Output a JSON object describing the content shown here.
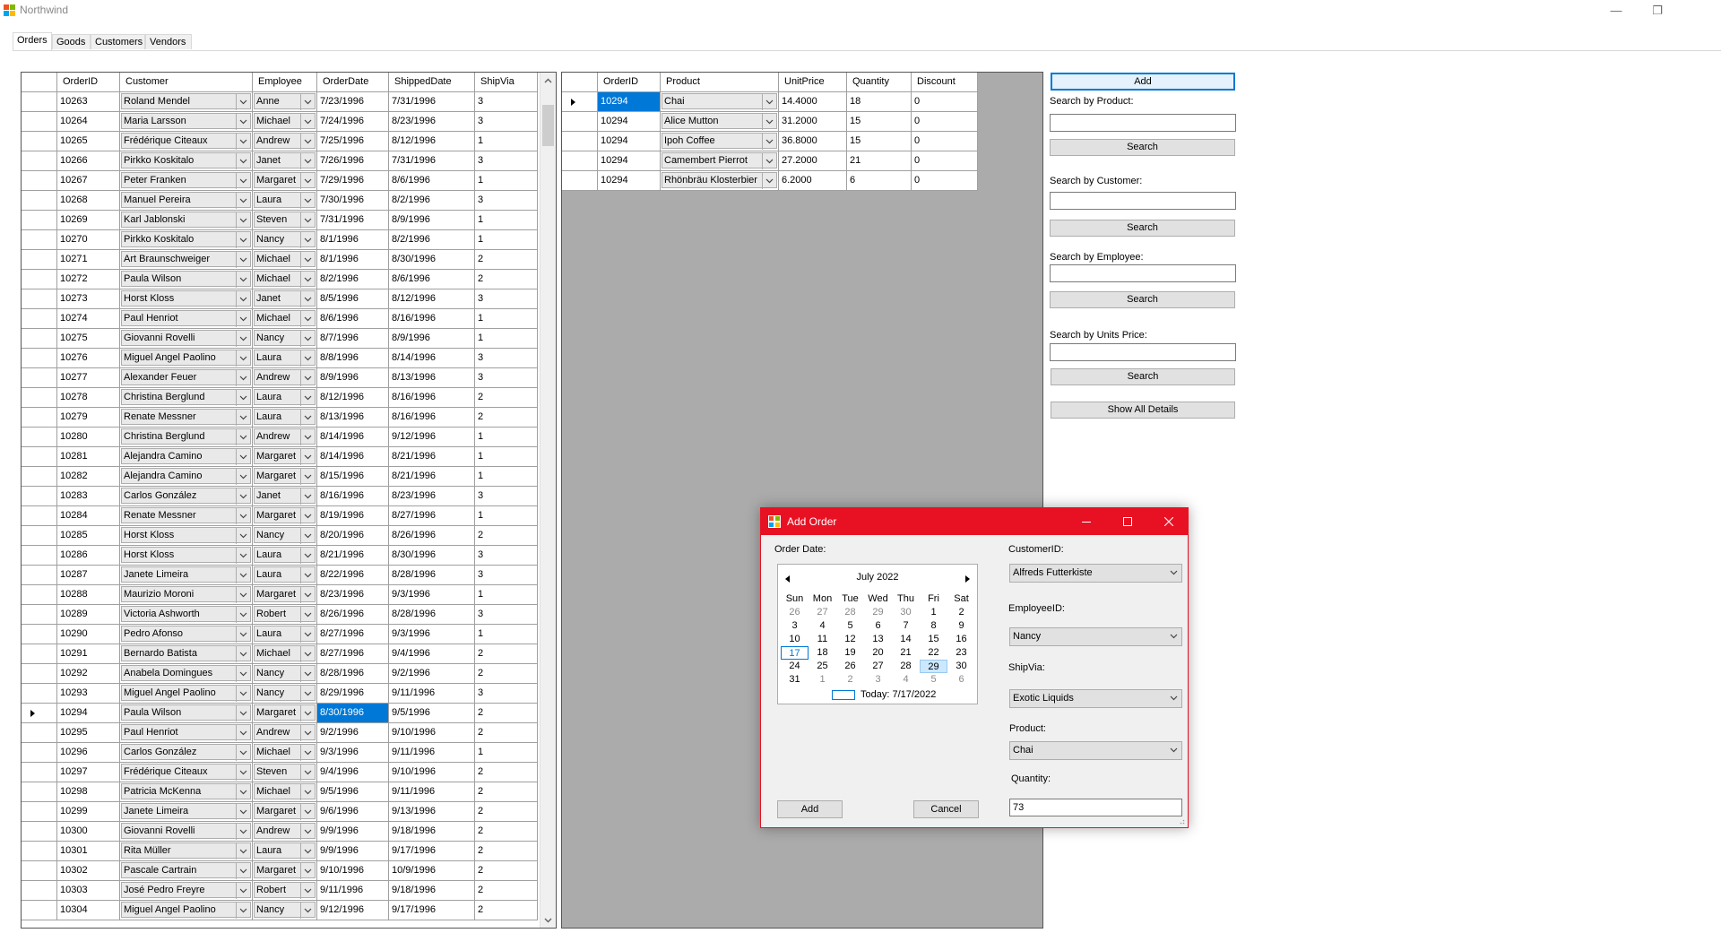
{
  "window": {
    "title": "Northwind",
    "controls": [
      "—",
      "❐"
    ]
  },
  "tabs": [
    {
      "label": "Orders",
      "active": true
    },
    {
      "label": "Goods",
      "active": false
    },
    {
      "label": "Customers",
      "active": false
    },
    {
      "label": "Vendors",
      "active": false
    }
  ],
  "orders_grid": {
    "columns": [
      "OrderID",
      "Customer",
      "Employee",
      "OrderDate",
      "ShippedDate",
      "ShipVia"
    ],
    "selected_order_id": "10294",
    "selected_cell": "OrderDate",
    "rows": [
      [
        "10263",
        "Roland Mendel",
        "Anne",
        "7/23/1996",
        "7/31/1996",
        "3"
      ],
      [
        "10264",
        "Maria Larsson",
        "Michael",
        "7/24/1996",
        "8/23/1996",
        "3"
      ],
      [
        "10265",
        "Frédérique Citeaux",
        "Andrew",
        "7/25/1996",
        "8/12/1996",
        "1"
      ],
      [
        "10266",
        "Pirkko Koskitalo",
        "Janet",
        "7/26/1996",
        "7/31/1996",
        "3"
      ],
      [
        "10267",
        "Peter Franken",
        "Margaret",
        "7/29/1996",
        "8/6/1996",
        "1"
      ],
      [
        "10268",
        "Manuel Pereira",
        "Laura",
        "7/30/1996",
        "8/2/1996",
        "3"
      ],
      [
        "10269",
        "Karl Jablonski",
        "Steven",
        "7/31/1996",
        "8/9/1996",
        "1"
      ],
      [
        "10270",
        "Pirkko Koskitalo",
        "Nancy",
        "8/1/1996",
        "8/2/1996",
        "1"
      ],
      [
        "10271",
        "Art Braunschweiger",
        "Michael",
        "8/1/1996",
        "8/30/1996",
        "2"
      ],
      [
        "10272",
        "Paula Wilson",
        "Michael",
        "8/2/1996",
        "8/6/1996",
        "2"
      ],
      [
        "10273",
        "Horst Kloss",
        "Janet",
        "8/5/1996",
        "8/12/1996",
        "3"
      ],
      [
        "10274",
        "Paul Henriot",
        "Michael",
        "8/6/1996",
        "8/16/1996",
        "1"
      ],
      [
        "10275",
        "Giovanni Rovelli",
        "Nancy",
        "8/7/1996",
        "8/9/1996",
        "1"
      ],
      [
        "10276",
        "Miguel Angel Paolino",
        "Laura",
        "8/8/1996",
        "8/14/1996",
        "3"
      ],
      [
        "10277",
        "Alexander Feuer",
        "Andrew",
        "8/9/1996",
        "8/13/1996",
        "3"
      ],
      [
        "10278",
        "Christina Berglund",
        "Laura",
        "8/12/1996",
        "8/16/1996",
        "2"
      ],
      [
        "10279",
        "Renate Messner",
        "Laura",
        "8/13/1996",
        "8/16/1996",
        "2"
      ],
      [
        "10280",
        "Christina Berglund",
        "Andrew",
        "8/14/1996",
        "9/12/1996",
        "1"
      ],
      [
        "10281",
        "Alejandra Camino",
        "Margaret",
        "8/14/1996",
        "8/21/1996",
        "1"
      ],
      [
        "10282",
        "Alejandra Camino",
        "Margaret",
        "8/15/1996",
        "8/21/1996",
        "1"
      ],
      [
        "10283",
        "Carlos González",
        "Janet",
        "8/16/1996",
        "8/23/1996",
        "3"
      ],
      [
        "10284",
        "Renate Messner",
        "Margaret",
        "8/19/1996",
        "8/27/1996",
        "1"
      ],
      [
        "10285",
        "Horst Kloss",
        "Nancy",
        "8/20/1996",
        "8/26/1996",
        "2"
      ],
      [
        "10286",
        "Horst Kloss",
        "Laura",
        "8/21/1996",
        "8/30/1996",
        "3"
      ],
      [
        "10287",
        "Janete Limeira",
        "Laura",
        "8/22/1996",
        "8/28/1996",
        "3"
      ],
      [
        "10288",
        "Maurizio Moroni",
        "Margaret",
        "8/23/1996",
        "9/3/1996",
        "1"
      ],
      [
        "10289",
        "Victoria Ashworth",
        "Robert",
        "8/26/1996",
        "8/28/1996",
        "3"
      ],
      [
        "10290",
        "Pedro Afonso",
        "Laura",
        "8/27/1996",
        "9/3/1996",
        "1"
      ],
      [
        "10291",
        "Bernardo Batista",
        "Michael",
        "8/27/1996",
        "9/4/1996",
        "2"
      ],
      [
        "10292",
        "Anabela Domingues",
        "Nancy",
        "8/28/1996",
        "9/2/1996",
        "2"
      ],
      [
        "10293",
        "Miguel Angel Paolino",
        "Nancy",
        "8/29/1996",
        "9/11/1996",
        "3"
      ],
      [
        "10294",
        "Paula Wilson",
        "Margaret",
        "8/30/1996",
        "9/5/1996",
        "2"
      ],
      [
        "10295",
        "Paul Henriot",
        "Andrew",
        "9/2/1996",
        "9/10/1996",
        "2"
      ],
      [
        "10296",
        "Carlos González",
        "Michael",
        "9/3/1996",
        "9/11/1996",
        "1"
      ],
      [
        "10297",
        "Frédérique Citeaux",
        "Steven",
        "9/4/1996",
        "9/10/1996",
        "2"
      ],
      [
        "10298",
        "Patricia McKenna",
        "Michael",
        "9/5/1996",
        "9/11/1996",
        "2"
      ],
      [
        "10299",
        "Janete Limeira",
        "Margaret",
        "9/6/1996",
        "9/13/1996",
        "2"
      ],
      [
        "10300",
        "Giovanni Rovelli",
        "Andrew",
        "9/9/1996",
        "9/18/1996",
        "2"
      ],
      [
        "10301",
        "Rita Müller",
        "Laura",
        "9/9/1996",
        "9/17/1996",
        "2"
      ],
      [
        "10302",
        "Pascale Cartrain",
        "Margaret",
        "9/10/1996",
        "10/9/1996",
        "2"
      ],
      [
        "10303",
        "José Pedro Freyre",
        "Robert",
        "9/11/1996",
        "9/18/1996",
        "2"
      ],
      [
        "10304",
        "Miguel Angel Paolino",
        "Nancy",
        "9/12/1996",
        "9/17/1996",
        "2"
      ]
    ]
  },
  "details_grid": {
    "columns": [
      "OrderID",
      "Product",
      "UnitPrice",
      "Quantity",
      "Discount"
    ],
    "rows": [
      [
        "10294",
        "Chai",
        "14.4000",
        "18",
        "0"
      ],
      [
        "10294",
        "Alice Mutton",
        "31.2000",
        "15",
        "0"
      ],
      [
        "10294",
        "Ipoh Coffee",
        "36.8000",
        "15",
        "0"
      ],
      [
        "10294",
        "Camembert Pierrot",
        "27.2000",
        "21",
        "0"
      ],
      [
        "10294",
        "Rhönbräu Klosterbier",
        "6.2000",
        "6",
        "0"
      ]
    ]
  },
  "side_panel": {
    "add_label": "Add",
    "search_product_label": "Search by Product:",
    "search_customer_label": "Search by Customer:",
    "search_employee_label": "Search by Employee:",
    "search_price_label": "Search by Units Price:",
    "search_button": "Search",
    "show_all_label": "Show All Details"
  },
  "dialog": {
    "title": "Add Order",
    "order_date_label": "Order Date:",
    "customer_label": "CustomerID:",
    "customer_value": "Alfreds Futterkiste",
    "employee_label": "EmployeeID:",
    "employee_value": "Nancy",
    "shipvia_label": "ShipVia:",
    "shipvia_value": "Exotic Liquids",
    "product_label": "Product:",
    "product_value": "Chai",
    "quantity_label": "Quantity:",
    "quantity_value": "73",
    "add_button": "Add",
    "cancel_button": "Cancel",
    "accent_color": "#e81123",
    "calendar": {
      "month": "July 2022",
      "weekdays": [
        "Sun",
        "Mon",
        "Tue",
        "Wed",
        "Thu",
        "Fri",
        "Sat"
      ],
      "weeks": [
        [
          "26",
          "27",
          "28",
          "29",
          "30",
          "1",
          "2"
        ],
        [
          "3",
          "4",
          "5",
          "6",
          "7",
          "8",
          "9"
        ],
        [
          "10",
          "11",
          "12",
          "13",
          "14",
          "15",
          "16"
        ],
        [
          "17",
          "18",
          "19",
          "20",
          "21",
          "22",
          "23"
        ],
        [
          "24",
          "25",
          "26",
          "27",
          "28",
          "29",
          "30"
        ],
        [
          "31",
          "1",
          "2",
          "3",
          "4",
          "5",
          "6"
        ]
      ],
      "today_day": "17",
      "selected_day": "29",
      "today_text": "Today: 7/17/2022"
    }
  }
}
